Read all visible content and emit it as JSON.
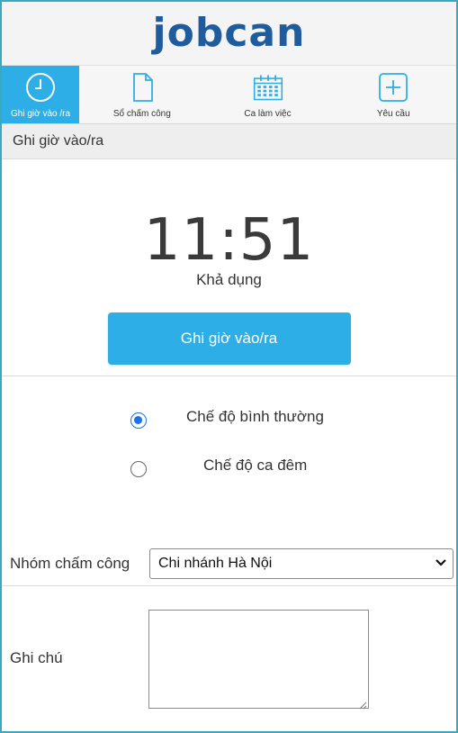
{
  "header": {
    "logo": "jobcan"
  },
  "nav": {
    "items": [
      {
        "label": "Ghi giờ vào /ra",
        "icon": "clock-icon",
        "active": true
      },
      {
        "label": "Sổ chấm công",
        "icon": "document-icon",
        "active": false
      },
      {
        "label": "Ca làm việc",
        "icon": "calendar-icon",
        "active": false
      },
      {
        "label": "Yêu cầu",
        "icon": "plus-icon",
        "active": false
      }
    ]
  },
  "section": {
    "title": "Ghi giờ vào/ra"
  },
  "clock": {
    "time": "11:51",
    "status": "Khả dụng"
  },
  "punch": {
    "label": "Ghi giờ vào/ra"
  },
  "modes": {
    "normal": {
      "label": "Chế độ bình thường",
      "checked": true
    },
    "night": {
      "label": "Chế độ ca đêm",
      "checked": false
    }
  },
  "group": {
    "label": "Nhóm chấm công",
    "selected": "Chi nhánh Hà Nội"
  },
  "note": {
    "label": "Ghi chú",
    "value": ""
  },
  "colors": {
    "accent": "#2eaee6",
    "logo": "#1f5c9e",
    "radio": "#1a73e8",
    "frame": "#3aa9c0"
  }
}
